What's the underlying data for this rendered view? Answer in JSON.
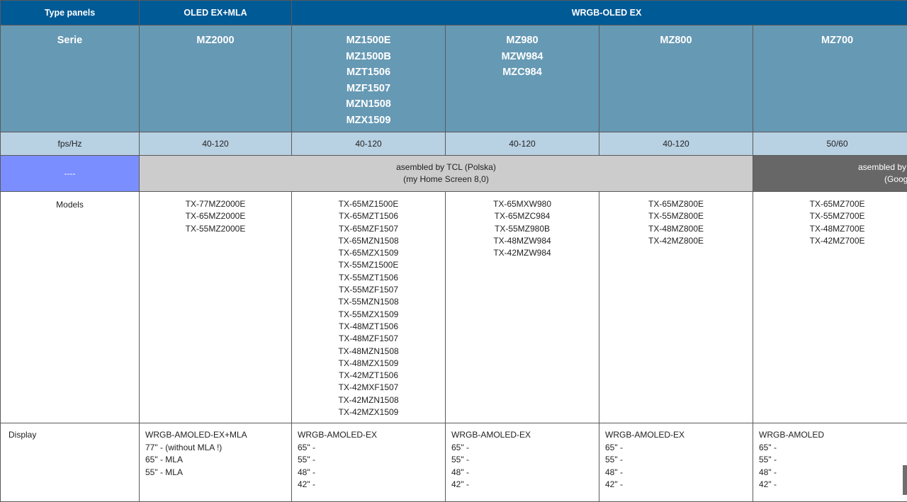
{
  "header": {
    "type_panels_label": "Type panels",
    "oled_ex_mla": "OLED EX+MLA",
    "wrgb_oled_ex": "WRGB-OLED EX"
  },
  "serie": {
    "label": "Serie",
    "mz2000": [
      "MZ2000"
    ],
    "mz1500": [
      "MZ1500E",
      "MZ1500B",
      "MZT1506",
      "MZF1507",
      "MZN1508",
      "MZX1509"
    ],
    "mz980": [
      "MZ980",
      "MZW984",
      "MZC984"
    ],
    "mz800": [
      "MZ800"
    ],
    "mz700": [
      "MZ700"
    ]
  },
  "fps": {
    "label": "fps/Hz",
    "values": [
      "40-120",
      "40-120",
      "40-120",
      "40-120",
      "50/60"
    ]
  },
  "assembly": {
    "label": "----",
    "tcl_line1": "asembled by TCL (Polska)",
    "tcl_line2": "(my Home Screen 8,0)",
    "other_line1": "asembled by T",
    "other_line2": "(Goog",
    "colors": {
      "label_bg": "#7b8eff",
      "tcl_bg": "#cccccc",
      "other_bg": "#676767"
    }
  },
  "models": {
    "label": "Models",
    "mz2000": [
      "TX-77MZ2000E",
      "TX-65MZ2000E",
      "TX-55MZ2000E"
    ],
    "mz1500": [
      "TX-65MZ1500E",
      "TX-65MZT1506",
      "TX-65MZF1507",
      "TX-65MZN1508",
      "TX-65MZX1509",
      "TX-55MZ1500E",
      "TX-55MZT1506",
      "TX-55MZF1507",
      "TX-55MZN1508",
      "TX-55MZX1509",
      "TX-48MZT1506",
      "TX-48MZF1507",
      "TX-48MZN1508",
      "TX-48MZX1509",
      "TX-42MZT1506",
      "TX-42MXF1507",
      "TX-42MZN1508",
      "TX-42MZX1509"
    ],
    "mz980": [
      "TX-65MXW980",
      "TX-65MZC984",
      "TX-55MZ980B",
      "TX-48MZW984",
      "TX-42MZW984"
    ],
    "mz800": [
      "TX-65MZ800E",
      "TX-55MZ800E",
      "TX-48MZ800E",
      "TX-42MZ800E"
    ],
    "mz700": [
      "TX-65MZ700E",
      "TX-55MZ700E",
      "TX-48MZ700E",
      "TX-42MZ700E"
    ]
  },
  "display": {
    "label": "Display",
    "mz2000": [
      "WRGB-AMOLED-EX+MLA",
      "77\" - (without MLA !)",
      "65\" - MLA",
      "55\" - MLA"
    ],
    "mz1500": [
      "WRGB-AMOLED-EX",
      "65\" -",
      "55\" -",
      "48\" -",
      "42\" -"
    ],
    "mz980": [
      "WRGB-AMOLED-EX",
      "65\" -",
      "55\" -",
      "48\" -",
      "42\" -"
    ],
    "mz800": [
      "WRGB-AMOLED-EX",
      "65\" -",
      "55\" -",
      "48\" -",
      "42\" -"
    ],
    "mz700": [
      "WRGB-AMOLED",
      "65\" -",
      "55\" -",
      "48\" -",
      "42\" -"
    ]
  },
  "colors": {
    "header_bg": "#005a96",
    "serie_bg": "#6699b4",
    "fps_bg": "#b8d1e3"
  }
}
